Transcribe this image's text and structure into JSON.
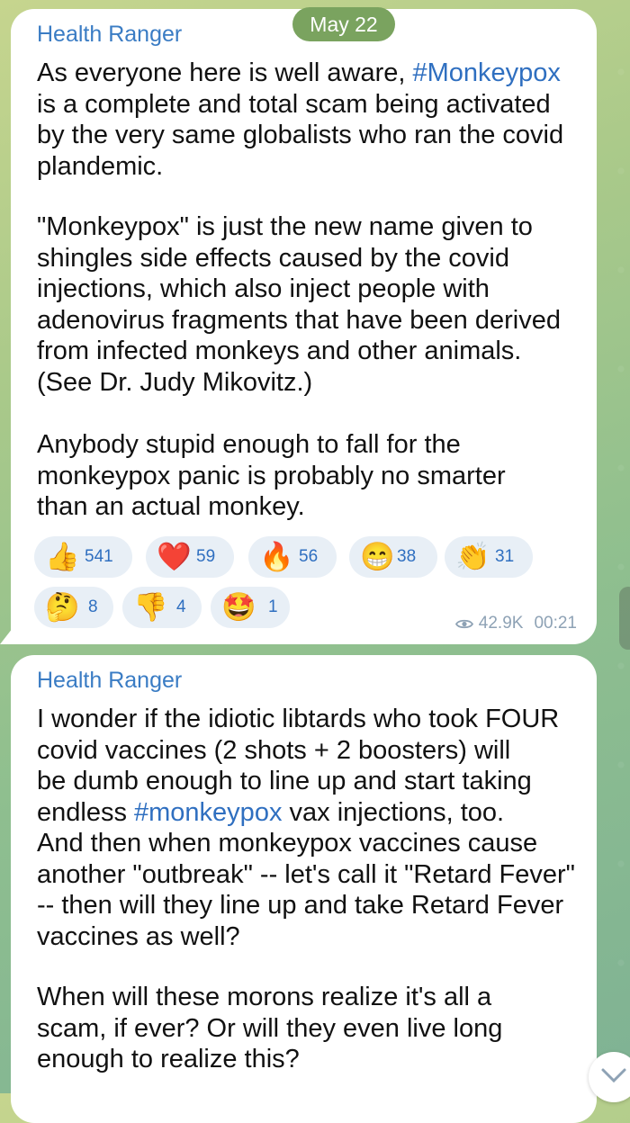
{
  "chat": {
    "date": "May 22",
    "post1": {
      "sender": "Health Ranger",
      "p1_before": "As everyone here is well aware, ",
      "p1_hashtag": "#Monkeypox",
      "p1_after": "\nis a complete and total scam being activated\nby the very same globalists who ran the covid\nplandemic.",
      "p2": "\"Monkeypox\" is just the new name given to\nshingles side effects caused by the covid\ninjections, which also inject people with\nadenovirus fragments that have been derived\nfrom infected monkeys and other animals.\n(See Dr. Judy Mikovitz.)",
      "p3": "Anybody stupid enough to fall for the\nmonkeypox panic is probably no smarter\nthan an actual monkey.",
      "reactions": [
        {
          "emoji": "👍",
          "icon": "thumbs-up-icon",
          "count": "541"
        },
        {
          "emoji": "❤️",
          "icon": "heart-icon",
          "count": "59"
        },
        {
          "emoji": "🔥",
          "icon": "fire-icon",
          "count": "56"
        },
        {
          "emoji": "😁",
          "icon": "grinning-face-icon",
          "count": "38"
        },
        {
          "emoji": "👏",
          "icon": "clapping-hands-icon",
          "count": "31"
        },
        {
          "emoji": "🤔",
          "icon": "thinking-face-icon",
          "count": "8"
        },
        {
          "emoji": "👎",
          "icon": "thumbs-down-icon",
          "count": "4"
        },
        {
          "emoji": "🤩",
          "icon": "star-struck-icon",
          "count": "1"
        }
      ],
      "views": "42.9K",
      "time": "00:21"
    },
    "post2": {
      "sender": "Health Ranger",
      "p1_before": "I wonder if the idiotic libtards who took FOUR\ncovid vaccines (2 shots + 2 boosters) will\nbe dumb enough to line up and start taking\nendless ",
      "p1_hashtag": "#monkeypox",
      "p1_after": " vax injections, too.\nAnd then when monkeypox vaccines cause\nanother \"outbreak\" -- let's call it \"Retard Fever\"\n-- then will they line up and take Retard Fever\nvaccines as well?",
      "p2": "When will these morons realize it's all a\nscam, if ever? Or will they even live long\nenough to realize this?"
    }
  }
}
